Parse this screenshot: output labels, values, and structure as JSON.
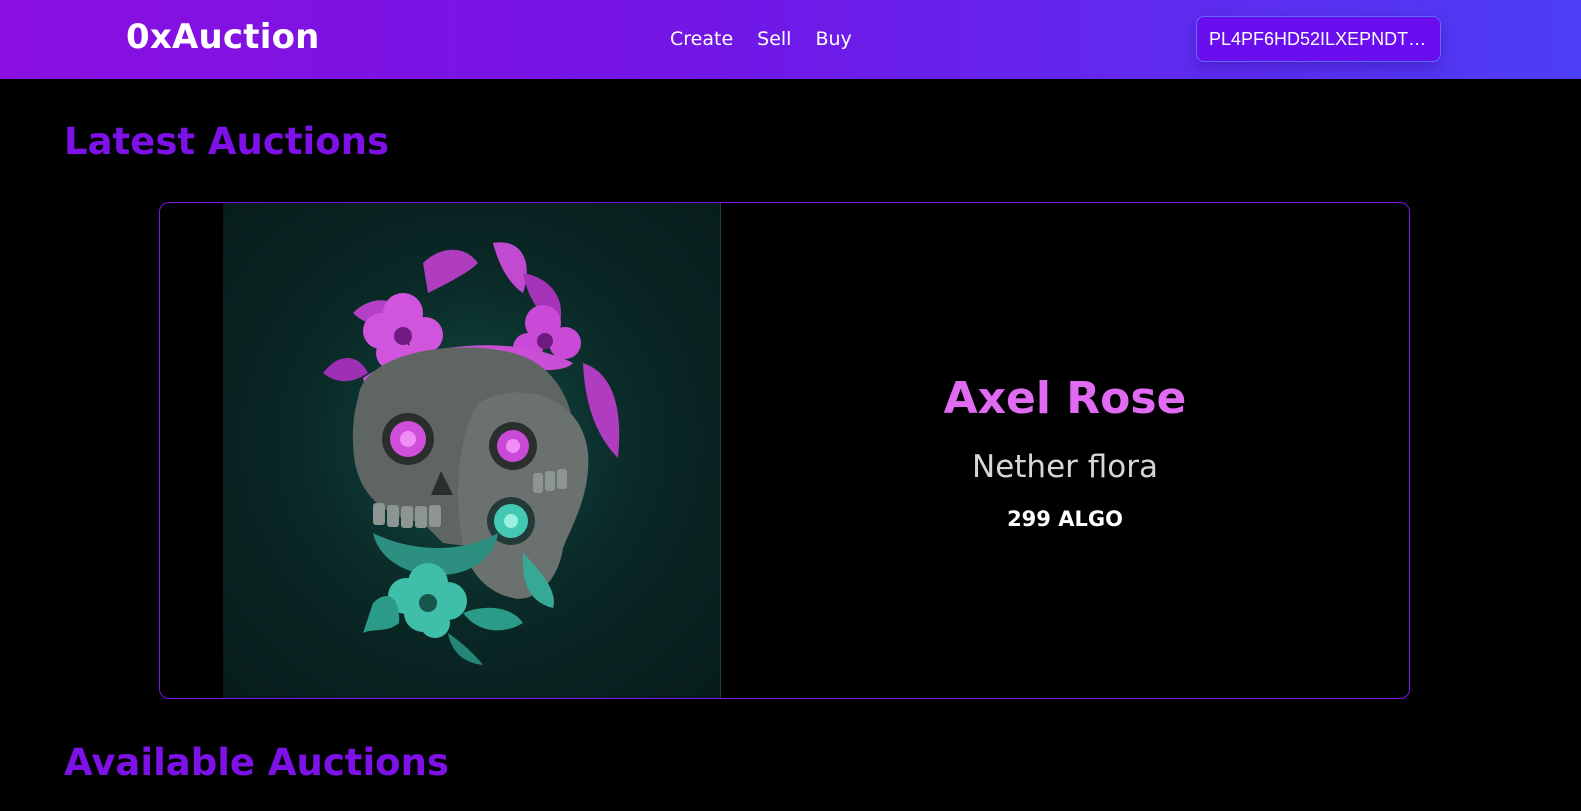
{
  "header": {
    "brand": "0xAuction",
    "nav": [
      {
        "label": "Create"
      },
      {
        "label": "Sell"
      },
      {
        "label": "Buy"
      }
    ],
    "wallet_address": "PL4PF6HD52ILXEPNDTT..."
  },
  "sections": {
    "latest_title": "Latest Auctions",
    "available_title": "Available Auctions"
  },
  "featured": {
    "name": "Axel Rose",
    "collection": "Nether flora",
    "price": "299 ALGO",
    "image_icon": "skull-flowers-artwork"
  },
  "colors": {
    "accent": "#7d11e8",
    "nft_name": "#e06bf2",
    "header_gradient_start": "#8a0fe0",
    "header_gradient_end": "#4c3ef5",
    "background": "#000000"
  }
}
